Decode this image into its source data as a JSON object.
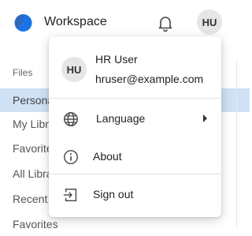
{
  "header": {
    "app_title": "Workspace",
    "logo_icon": "app-logo-icon",
    "notification_icon": "bell-icon",
    "avatar_initials": "HU",
    "brand_color": "#1a73e8"
  },
  "sidebar": {
    "section_label": "Files",
    "items": [
      {
        "label": "Personal Files",
        "active": true
      },
      {
        "label": "My Libraries",
        "active": false
      },
      {
        "label": "Favorite Libraries",
        "active": false
      },
      {
        "label": "All Libraries",
        "active": false
      },
      {
        "label": "Recent Files",
        "active": false
      },
      {
        "label": "Favorites",
        "active": false
      }
    ],
    "active_color": "#cfe1f5"
  },
  "user_menu": {
    "avatar_initials": "HU",
    "user_name": "HR User",
    "user_email": "hruser@example.com",
    "items": [
      {
        "label": "Language",
        "icon": "globe-icon",
        "has_submenu": true
      },
      {
        "label": "About",
        "icon": "info-icon",
        "has_submenu": false
      },
      {
        "label": "Sign out",
        "icon": "sign-out-icon",
        "has_submenu": false
      }
    ]
  }
}
